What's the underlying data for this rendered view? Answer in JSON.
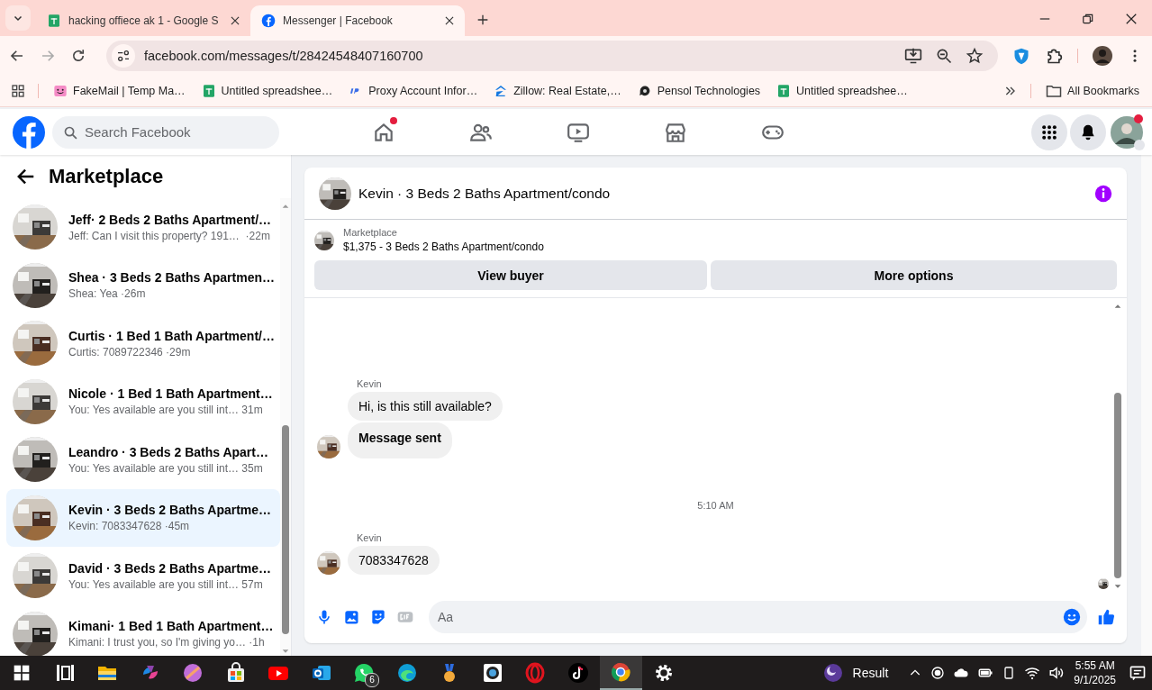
{
  "browser": {
    "tabs": [
      {
        "title": "hacking offiece ak 1 - Google S",
        "kind": "sheets",
        "selected": false
      },
      {
        "title": "Messenger | Facebook",
        "kind": "facebook",
        "selected": true
      }
    ],
    "address": "facebook.com/messages/t/28424548407160700",
    "bookmarks": [
      {
        "label": "FakeMail | Temp Ma…",
        "kind": "smiley"
      },
      {
        "label": "Untitled spreadshee…",
        "kind": "sheets"
      },
      {
        "label": "Proxy Account Infor…",
        "kind": "proxy"
      },
      {
        "label": "Zillow: Real Estate,…",
        "kind": "house"
      },
      {
        "label": "Pensol Technologies",
        "kind": "pensol"
      },
      {
        "label": "Untitled spreadshee…",
        "kind": "sheets"
      }
    ],
    "all_bookmarks": "All Bookmarks"
  },
  "topbar": {
    "search_placeholder": "Search Facebook",
    "nav": [
      {
        "kind": "home",
        "dot": true
      },
      {
        "kind": "friends",
        "dot": false
      },
      {
        "kind": "video",
        "dot": false
      },
      {
        "kind": "shop",
        "dot": false
      },
      {
        "kind": "game",
        "dot": false
      }
    ]
  },
  "sidebar": {
    "title": "Marketplace",
    "conversations": [
      {
        "title": "Jeff· 2 Beds 2 Baths Apartment/…",
        "preview": "Jeff: Can I visit this property? 191… ",
        "time": "·22m",
        "selected": false
      },
      {
        "title": "Shea · 3 Beds 2 Baths Apartmen…",
        "preview": "Shea: Yea",
        "time": "·26m",
        "selected": false
      },
      {
        "title": "Curtis · 1 Bed 1 Bath Apartment/…",
        "preview": "Curtis: 7089722346",
        "time": "·29m",
        "selected": false
      },
      {
        "title": "Nicole · 1 Bed 1 Bath Apartment…",
        "preview": "You: Yes available are you still int…",
        "time": "31m",
        "selected": false
      },
      {
        "title": "Leandro · 3 Beds 2 Baths Apart…",
        "preview": "You: Yes available are you still int…",
        "time": "35m",
        "selected": false
      },
      {
        "title": "Kevin · 3 Beds 2 Baths Apartme…",
        "preview": "Kevin: 7083347628",
        "time": "·45m",
        "selected": true
      },
      {
        "title": "David · 3 Beds 2 Baths Apartme…",
        "preview": "You: Yes available are you still int…",
        "time": "57m",
        "selected": false
      },
      {
        "title": "Kimani· 1 Bed 1 Bath Apartment…",
        "preview": "Kimani: I trust you, so I'm giving yo…",
        "time": "·1h",
        "selected": false
      }
    ]
  },
  "chat": {
    "title": "Kevin · 3 Beds 2 Baths Apartment/condo",
    "listing_label": "Marketplace",
    "listing_title": "$1,375 - 3 Beds 2 Baths Apartment/condo",
    "buttons": [
      "View buyer",
      "More options"
    ],
    "messages": [
      {
        "kind": "sender",
        "text": "Kevin"
      },
      {
        "kind": "bubble",
        "text": "Hi, is this still available?",
        "bold": false,
        "avatar": false
      },
      {
        "kind": "bubble",
        "text": "Message sent",
        "bold": true,
        "avatar": true
      },
      {
        "kind": "timestamp",
        "text": "5:10 AM"
      },
      {
        "kind": "sender",
        "text": "Kevin"
      },
      {
        "kind": "bubble",
        "text": "7083347628",
        "bold": false,
        "avatar": true
      }
    ],
    "composer_placeholder": "Aa"
  },
  "taskbar": {
    "apps": [
      {
        "kind": "taskview",
        "selected": false
      },
      {
        "kind": "folder",
        "selected": false
      },
      {
        "kind": "swirl",
        "selected": false
      },
      {
        "kind": "ball",
        "selected": false
      },
      {
        "kind": "store",
        "selected": false
      },
      {
        "kind": "play",
        "selected": false
      },
      {
        "kind": "mail",
        "selected": false
      },
      {
        "kind": "chat",
        "selected": false,
        "badge": "6"
      },
      {
        "kind": "wave",
        "selected": false
      },
      {
        "kind": "medal",
        "selected": false
      },
      {
        "kind": "square",
        "selected": false
      },
      {
        "kind": "ring",
        "selected": false
      },
      {
        "kind": "note",
        "selected": false
      },
      {
        "kind": "globe",
        "selected": true
      },
      {
        "kind": "gear",
        "selected": false
      }
    ],
    "weather": "Result",
    "time": "5:55 AM",
    "date": "9/1/2025"
  }
}
